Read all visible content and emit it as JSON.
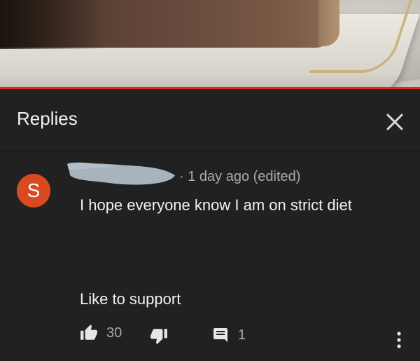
{
  "panel": {
    "title": "Replies"
  },
  "video": {
    "progress_fraction": 1.0,
    "progress_color": "#e62117"
  },
  "comment": {
    "avatar_letter": "S",
    "avatar_color": "#d84a20",
    "time": "· 1 day ago (edited)",
    "text_line1": "I hope everyone know I am on strict diet",
    "text_line2": "Like to support",
    "likes": "30",
    "replies": "1"
  },
  "icons": {
    "close": "close-icon",
    "like": "thumbs-up-icon",
    "dislike": "thumbs-down-icon",
    "reply": "comment-icon",
    "more": "more-vertical-icon"
  }
}
